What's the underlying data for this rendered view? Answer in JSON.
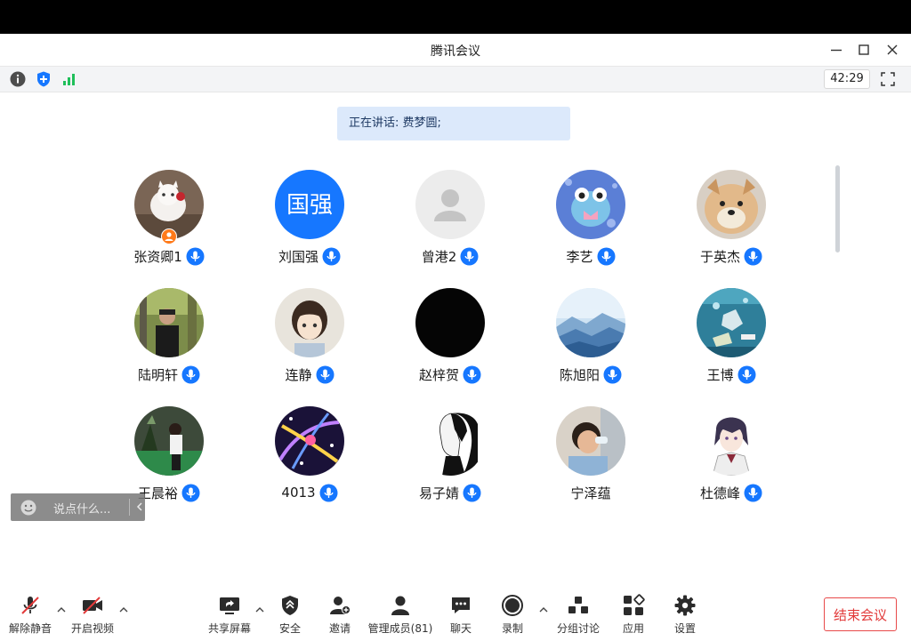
{
  "window": {
    "title": "腾讯会议",
    "timer": "42:29"
  },
  "speaker_banner": "正在讲话: 费梦圆;",
  "participants": [
    {
      "name": "张资卿1",
      "avatar": "white-cat-photo",
      "host": true
    },
    {
      "name": "刘国强",
      "avatar_text": "国强",
      "avatar_color": "#1677ff"
    },
    {
      "name": "曾港2",
      "avatar": "default-person"
    },
    {
      "name": "李艺",
      "avatar": "cartoon-frog"
    },
    {
      "name": "于英杰",
      "avatar": "puppy-photo"
    },
    {
      "name": "陆明轩",
      "avatar": "man-photo"
    },
    {
      "name": "连静",
      "avatar": "cartoon-girl"
    },
    {
      "name": "赵梓贺",
      "avatar": "black"
    },
    {
      "name": "陈旭阳",
      "avatar": "blue-mountains"
    },
    {
      "name": "王博",
      "avatar": "underwater-poster"
    },
    {
      "name": "王晨裕",
      "avatar": "girl-photo"
    },
    {
      "name": "4013",
      "avatar": "purple-abstract"
    },
    {
      "name": "易子婧",
      "avatar": "sketch-girl"
    },
    {
      "name": "宁泽蕴",
      "avatar": "child-photo"
    },
    {
      "name": "杜德峰",
      "avatar": "anime-boy"
    }
  ],
  "chat": {
    "placeholder": "说点什么..."
  },
  "toolbar": {
    "unmute": "解除静音",
    "start_video": "开启视频",
    "share_screen": "共享屏幕",
    "security": "安全",
    "invite": "邀请",
    "manage_members": "管理成员(81)",
    "chat": "聊天",
    "record": "录制",
    "breakout": "分组讨论",
    "apps": "应用",
    "settings": "设置",
    "end_meeting": "结束会议"
  },
  "colors": {
    "accent": "#1677ff",
    "end_red": "#e23a3a",
    "banner_bg": "#dce9fb"
  }
}
